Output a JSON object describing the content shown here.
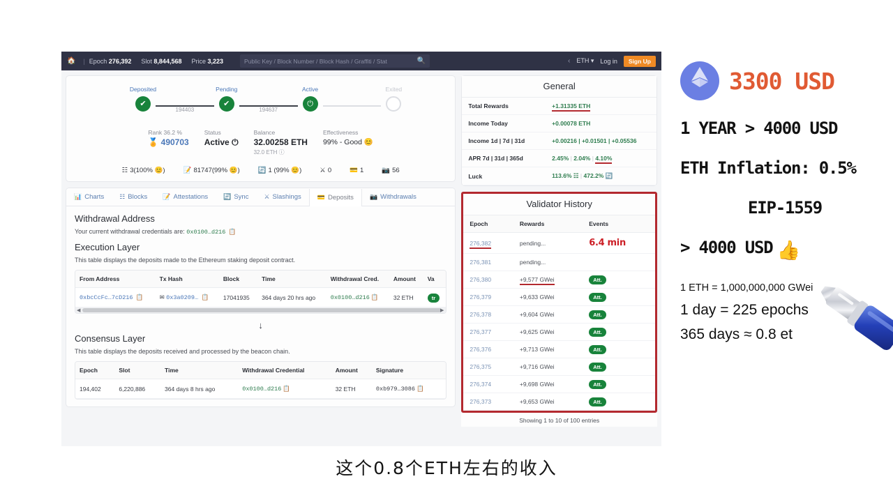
{
  "navbar": {
    "home_icon": "home-icon",
    "epoch_label": "Epoch",
    "epoch_value": "276,392",
    "slot_label": "Slot",
    "slot_value": "8,844,568",
    "price_label": "Price",
    "price_value": "3,223",
    "search_placeholder": "Public Key / Block Number / Block Hash / Graffiti / Stat",
    "search_icon": "search-icon",
    "chevron_icon": "chevron-left-icon",
    "currency": "ETH",
    "currency_caret": "▾",
    "login": "Log in",
    "signup": "Sign Up",
    "signup_color": "#f08a24"
  },
  "summary": {
    "steps": [
      {
        "label": "Deposited",
        "state": "done",
        "glyph": "✔"
      },
      {
        "label": "Pending",
        "state": "done",
        "glyph": "✔"
      },
      {
        "label": "Active",
        "state": "active",
        "glyph": "⏻"
      },
      {
        "label": "Exited",
        "state": "empty",
        "glyph": ""
      }
    ],
    "connectors": [
      "194403",
      "194637",
      ""
    ],
    "stats": [
      {
        "key": "Rank 36.2 %",
        "value": "490703",
        "icon": "rank-medal-icon",
        "sub": ""
      },
      {
        "key": "Status",
        "value": "Active",
        "icon": "power-icon",
        "sub": ""
      },
      {
        "key": "Balance",
        "value": "32.00258 ETH",
        "icon": "",
        "sub": "32.0 ETH"
      },
      {
        "key": "Effectiveness",
        "value": "99% - Good",
        "icon": "smile-icon",
        "sub": ""
      }
    ],
    "icon_row": [
      {
        "icon": "blocks-icon",
        "text": "3(100% ",
        "pct_face": "☺",
        "tail": ")"
      },
      {
        "icon": "attestations-icon",
        "text": "81747(99% ",
        "pct_face": "☺",
        "tail": ")"
      },
      {
        "icon": "sync-icon",
        "text": "1 (99% ",
        "pct_face": "☺",
        "tail": ")"
      },
      {
        "icon": "slashings-icon",
        "text": "0",
        "pct_face": "",
        "tail": ""
      },
      {
        "icon": "deposits-icon",
        "text": "1",
        "pct_face": "",
        "tail": ""
      },
      {
        "icon": "withdrawals-icon",
        "text": "56",
        "pct_face": "",
        "tail": ""
      }
    ]
  },
  "tabs": [
    {
      "label": "Charts",
      "icon": "chart-icon",
      "active": false
    },
    {
      "label": "Blocks",
      "icon": "blocks-icon",
      "active": false
    },
    {
      "label": "Attestations",
      "icon": "attestations-icon",
      "active": false
    },
    {
      "label": "Sync",
      "icon": "sync-icon",
      "active": false
    },
    {
      "label": "Slashings",
      "icon": "slashings-icon",
      "active": false
    },
    {
      "label": "Deposits",
      "icon": "deposits-icon",
      "active": true
    },
    {
      "label": "Withdrawals",
      "icon": "withdrawals-icon",
      "active": false
    }
  ],
  "withdrawal": {
    "title": "Withdrawal Address",
    "text_prefix": "Your current withdrawal credentials are:",
    "credential": "0x0100…d216",
    "copy_icon": "copy-icon"
  },
  "execution_layer": {
    "title": "Execution Layer",
    "subtitle": "This table displays the deposits made to the Ethereum staking deposit contract.",
    "columns": [
      "From Address",
      "Tx Hash",
      "Block",
      "Time",
      "Withdrawal Cred.",
      "Amount",
      "Va"
    ],
    "rows": [
      {
        "from_address": "0xbcCcFc…7cD216",
        "tx_hash": "0x3a0209…",
        "block": "17041935",
        "time": "364 days 20 hrs ago",
        "withdrawal_cred": "0x0100…d216",
        "amount": "32 ETH",
        "valid_badge": "tr"
      }
    ],
    "scrollbar_icon": "horizontal-scrollbar"
  },
  "down_arrow": "↓",
  "consensus_layer": {
    "title": "Consensus Layer",
    "subtitle": "This table displays the deposits received and processed by the beacon chain.",
    "columns": [
      "Epoch",
      "Slot",
      "Time",
      "Withdrawal Credential",
      "Amount",
      "Signature"
    ],
    "rows": [
      {
        "epoch": "194,402",
        "slot": "6,220,886",
        "time": "364 days 8 hrs ago",
        "withdrawal_credential": "0x0100…d216",
        "amount": "32 ETH",
        "signature": "0xb979…3086"
      }
    ]
  },
  "general": {
    "title": "General",
    "rows": [
      {
        "key": "Total Rewards",
        "value": "+1.31335 ETH",
        "underlined": true
      },
      {
        "key": "Income Today",
        "value": "+0.00078 ETH",
        "underlined": false
      },
      {
        "key": "Income 1d | 7d | 31d",
        "value": "+0.00216 | +0.01501 | +0.05536",
        "underlined": false
      },
      {
        "key": "APR 7d | 31d | 365d",
        "value": "2.45% | 2.04% | 4.10%",
        "underlined": false,
        "last_underlined": "4.10%"
      },
      {
        "key": "Luck",
        "value": "113.6% | 472.2%",
        "underlined": false,
        "gray": true
      }
    ],
    "apr_parts": [
      "2.45%",
      "2.04%",
      "4.10%"
    ],
    "luck_parts": [
      "113.6%",
      "472.2%"
    ]
  },
  "validator_history": {
    "title": "Validator History",
    "highlight_color": "#b3292f",
    "columns": [
      "Epoch",
      "Rewards",
      "Events"
    ],
    "annotation": "6.4 min",
    "rows": [
      {
        "epoch": "276,382",
        "rewards": "pending...",
        "event": "",
        "epoch_underlined": true
      },
      {
        "epoch": "276,381",
        "rewards": "pending...",
        "event": ""
      },
      {
        "epoch": "276,380",
        "rewards": "+9,577 GWei",
        "event": "Att.",
        "rewards_underlined": true
      },
      {
        "epoch": "276,379",
        "rewards": "+9,633 GWei",
        "event": "Att."
      },
      {
        "epoch": "276,378",
        "rewards": "+9,604 GWei",
        "event": "Att."
      },
      {
        "epoch": "276,377",
        "rewards": "+9,625 GWei",
        "event": "Att."
      },
      {
        "epoch": "276,376",
        "rewards": "+9,713 GWei",
        "event": "Att."
      },
      {
        "epoch": "276,375",
        "rewards": "+9,716 GWei",
        "event": "Att."
      },
      {
        "epoch": "276,374",
        "rewards": "+9,698 GWei",
        "event": "Att."
      },
      {
        "epoch": "276,373",
        "rewards": "+9,653 GWei",
        "event": "Att."
      }
    ],
    "footer": "Showing 1 to 10 of 100 entries"
  },
  "notes": {
    "eth_icon": "ethereum-logo-icon",
    "price": "3300 USD",
    "price_color": "#e05a33",
    "line_year": "1 YEAR > 4000 USD",
    "line_inflation": "ETH Inflation: 0.5%",
    "line_eip": "EIP-1559",
    "line_target": "> 4000 USD",
    "thumbs_up_icon": "thumbs-up-icon",
    "note_gwei": "1 ETH = 1,000,000,000 GWei",
    "note_epochs": "1 day = 225 epochs",
    "note_days": "365 days ≈ 0.8 et",
    "pen_icon": "blue-pen-icon"
  },
  "subtitle": "这个0.8个ETH左右的收入"
}
